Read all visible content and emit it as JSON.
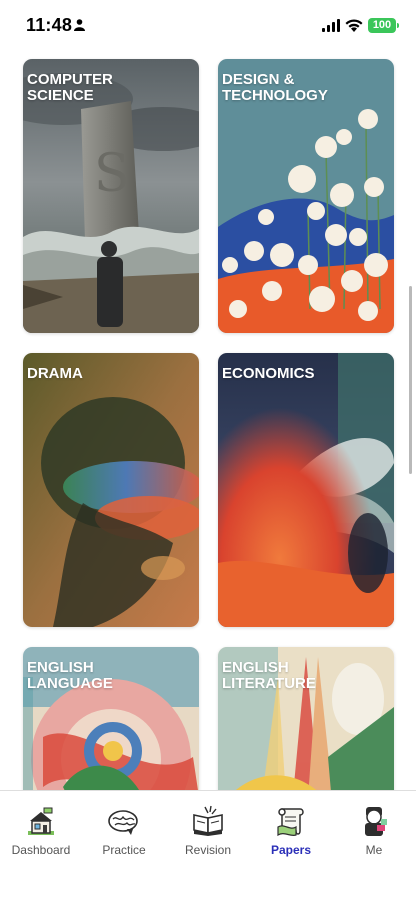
{
  "status_bar": {
    "time": "11:48",
    "battery": "100"
  },
  "subjects": [
    {
      "title": "Computer\nScience"
    },
    {
      "title": "Design &\nTechnology"
    },
    {
      "title": "Drama"
    },
    {
      "title": "Economics"
    },
    {
      "title": "English\nLanguage"
    },
    {
      "title": "English\nLiterature"
    }
  ],
  "bottom_nav": {
    "items": [
      {
        "label": "Dashboard",
        "icon": "house-icon"
      },
      {
        "label": "Practice",
        "icon": "brain-icon"
      },
      {
        "label": "Revision",
        "icon": "book-icon"
      },
      {
        "label": "Papers",
        "icon": "scroll-icon"
      },
      {
        "label": "Me",
        "icon": "avatar-icon"
      }
    ],
    "active": "Papers",
    "active_color": "#2b2fb8",
    "inactive_color": "#555555"
  }
}
